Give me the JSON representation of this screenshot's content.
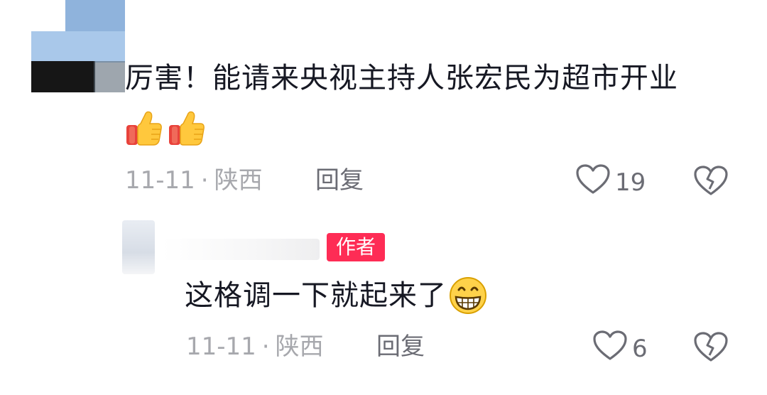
{
  "comments": [
    {
      "text": "厉害！能请来央视主持人张宏民为超市开业",
      "emoji": [
        "thumbs-up-emoji",
        "thumbs-up-emoji"
      ],
      "date": "11-11",
      "separator": "·",
      "location": "陕西",
      "reply_label": "回复",
      "like_count": "19"
    },
    {
      "author_badge": "作者",
      "text": "这格调一下就起来了",
      "emoji": [
        "grinning-emoji"
      ],
      "date": "11-11",
      "separator": "·",
      "location": "陕西",
      "reply_label": "回复",
      "like_count": "6"
    }
  ],
  "colors": {
    "text_primary": "#161823",
    "text_meta": "#a7a8ad",
    "text_action": "#6b6c74",
    "author_badge_bg": "#fe2c55"
  }
}
